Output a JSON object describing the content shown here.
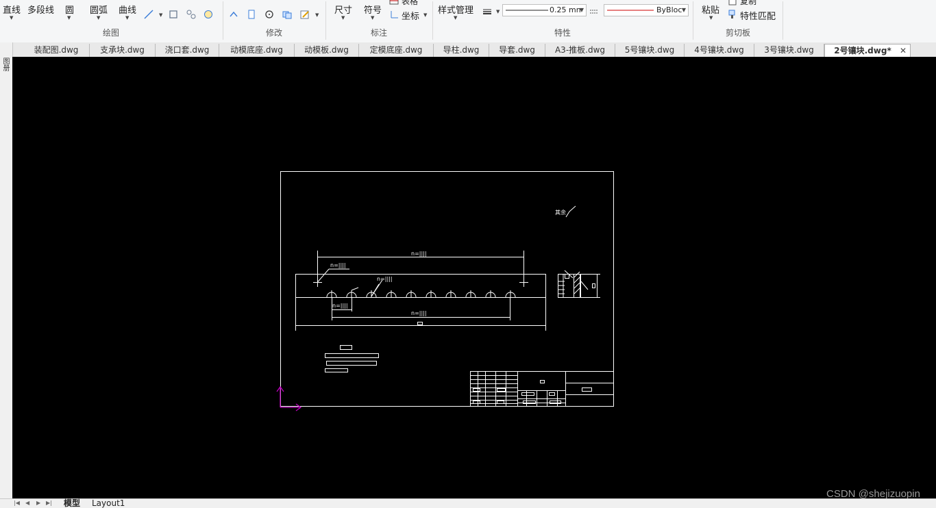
{
  "ribbon": {
    "draw": {
      "label": "绘图",
      "line": "直线",
      "polyline": "多段线",
      "circle": "圆",
      "arc": "圆弧",
      "curve": "曲线"
    },
    "modify": {
      "label": "修改"
    },
    "annotate": {
      "label": "标注",
      "dimension": "尺寸",
      "symbol": "符号",
      "table": "表格",
      "coordinate": "坐标"
    },
    "properties": {
      "label": "特性",
      "style_manager": "样式管理",
      "lineweight_value": "0.25 mn",
      "linetype_value": "ByBloc"
    },
    "clipboard": {
      "label": "剪切板",
      "paste": "粘贴",
      "copy": "复制",
      "match_properties": "特性匹配"
    }
  },
  "tabs": [
    {
      "label": "装配图.dwg"
    },
    {
      "label": "支承块.dwg"
    },
    {
      "label": "浇口套.dwg"
    },
    {
      "label": "动模底座.dwg"
    },
    {
      "label": "动模板.dwg"
    },
    {
      "label": "定模底座.dwg"
    },
    {
      "label": "导柱.dwg"
    },
    {
      "label": "导套.dwg"
    },
    {
      "label": "A3-推板.dwg"
    },
    {
      "label": "5号镶块.dwg"
    },
    {
      "label": "4号镶块.dwg"
    },
    {
      "label": "3号镶块.dwg"
    },
    {
      "label": "2号镶块.dwg*",
      "active": true
    }
  ],
  "left_strip": {
    "label": "图册"
  },
  "layout_tabs": [
    {
      "label": "模型",
      "active": true
    },
    {
      "label": "Layout1"
    }
  ],
  "watermark": "CSDN @shejizuopin",
  "drawing": {
    "roughness_mark": "其余",
    "dim_labels": [
      "n=||||",
      "n=||||",
      "n=||||",
      "n=||||",
      "n=||||"
    ]
  },
  "colors": {
    "canvas_bg": "#000000",
    "drawing_lines": "#ffffff",
    "ucs_icon": "#c000c0",
    "linetype_sample": "#cc0000"
  },
  "icons": {
    "ucs": "ucs-axis-icon"
  }
}
